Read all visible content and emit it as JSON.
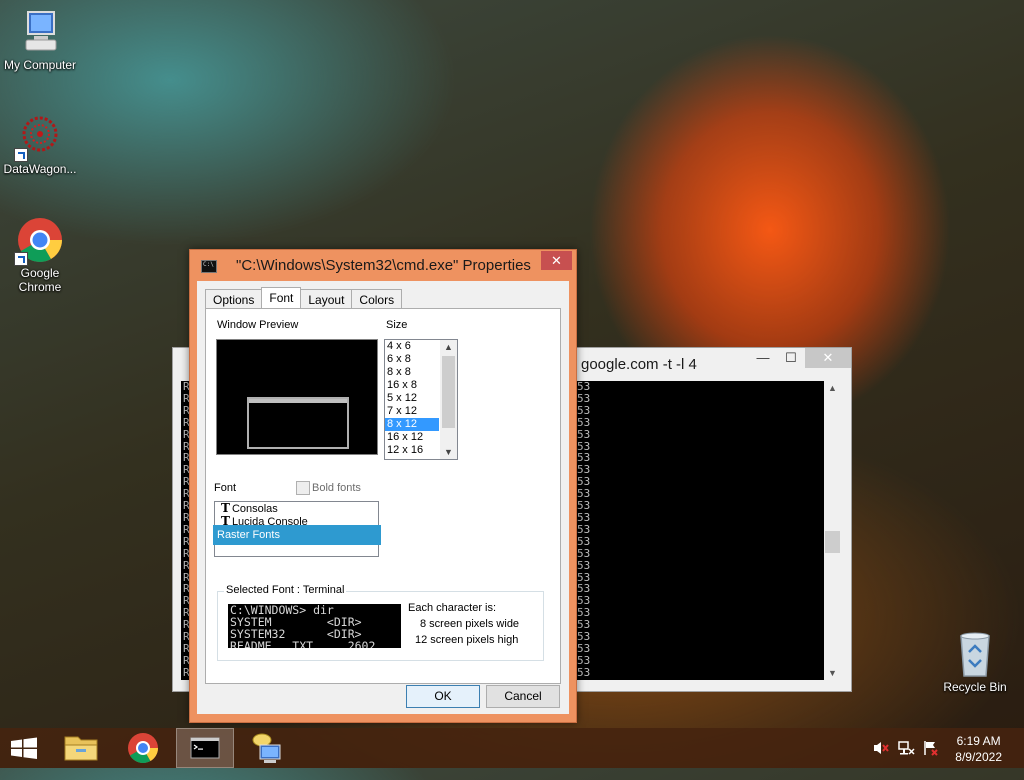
{
  "desktop": {
    "icons": [
      {
        "label": "My Computer",
        "icon": "computer-icon"
      },
      {
        "label": "DataWagon...",
        "icon": "datawagon-app-icon"
      },
      {
        "label": "Google\nChrome",
        "label_line1": "Google",
        "label_line2": "Chrome",
        "icon": "chrome-icon"
      },
      {
        "label": "Recycle Bin",
        "icon": "recycle-bin-icon"
      }
    ]
  },
  "console_window": {
    "title": "google.com -t -l 4",
    "left_column_char": "R",
    "right_column_text": "53",
    "line_count": 25,
    "controls": {
      "minimize": "—",
      "maximize": "☐",
      "close": "✕"
    }
  },
  "dialog": {
    "title": "\"C:\\Windows\\System32\\cmd.exe\" Properties",
    "close_glyph": "✕",
    "tabs": [
      "Options",
      "Font",
      "Layout",
      "Colors"
    ],
    "active_tab": "Font",
    "window_preview_label": "Window Preview",
    "size_label": "Size",
    "sizes": [
      "4 x  6",
      " 6 x  8",
      " 8 x  8",
      "16 x  8",
      " 5 x 12",
      " 7 x 12",
      " 8 x 12",
      "16 x 12",
      "12 x 16"
    ],
    "selected_size": " 8 x 12",
    "font_label": "Font",
    "bold_fonts_label": "Bold fonts",
    "bold_fonts_checked": false,
    "fonts": [
      "Consolas",
      "Lucida Console",
      "Raster Fonts"
    ],
    "selected_font": "Raster Fonts",
    "selected_font_caption": "Selected Font : Terminal",
    "sample_lines": [
      "C:\\WINDOWS> dir",
      "SYSTEM        <DIR>",
      "SYSTEM32      <DIR>",
      "README   TXT     2602"
    ],
    "each_character_label": "Each character is:",
    "width_text": "8 screen pixels wide",
    "height_text": "12 screen pixels high",
    "ok_label": "OK",
    "cancel_label": "Cancel"
  },
  "taskbar": {
    "items": [
      "start-button",
      "file-explorer",
      "chrome",
      "command-prompt",
      "network-app"
    ],
    "active_item": "command-prompt",
    "clock_time": "6:19 AM",
    "clock_date": "8/9/2022"
  },
  "colors": {
    "dialog_frame": "#ee9260",
    "close_button": "#c75050",
    "selection": "#3399ff",
    "font_highlight": "#2e9ad0"
  }
}
